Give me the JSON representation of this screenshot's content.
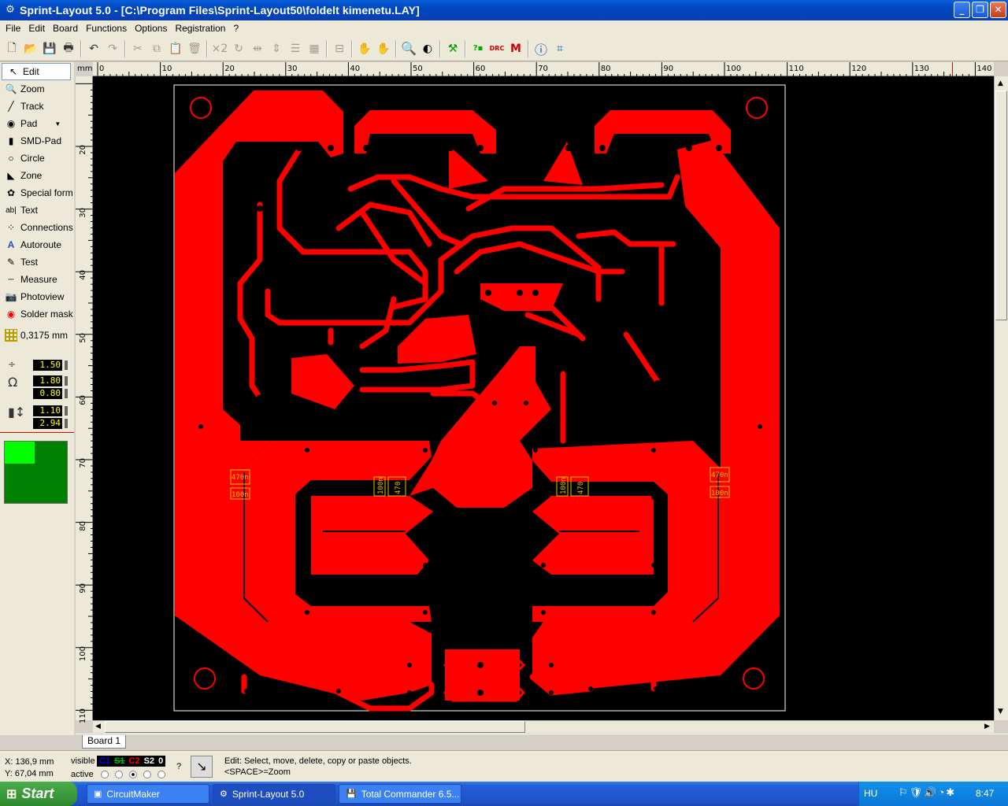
{
  "window": {
    "title": "Sprint-Layout 5.0 - [C:\\Program Files\\Sprint-Layout50\\foldelt kimenetu.LAY]",
    "minimize": "_",
    "maximize": "❐",
    "close": "✕"
  },
  "menu": [
    "File",
    "Edit",
    "Board",
    "Functions",
    "Options",
    "Registration",
    "?"
  ],
  "toolbar": {
    "icons": [
      "new-icon",
      "open-icon",
      "save-icon",
      "print-icon",
      "undo-icon",
      "redo-icon",
      "cut-icon",
      "copy-icon",
      "paste-icon",
      "delete-icon",
      "duplicate-icon",
      "rotate-icon",
      "mirror-h-icon",
      "mirror-v-icon",
      "align-icon",
      "group-icon",
      "ungroup-icon",
      "hide-icon",
      "lock-icon",
      "unlock-icon",
      "zoom-icon",
      "transparency-icon",
      "components-icon",
      "drc-icon",
      "drc-check-icon",
      "macro-icon",
      "info-icon",
      "crop-icon"
    ],
    "x2_label": "×2"
  },
  "tools": [
    {
      "label": "Edit",
      "icon": "pointer-icon"
    },
    {
      "label": "Zoom",
      "icon": "zoom-icon"
    },
    {
      "label": "Track",
      "icon": "track-icon"
    },
    {
      "label": "Pad",
      "icon": "pad-icon"
    },
    {
      "label": "SMD-Pad",
      "icon": "smd-pad-icon"
    },
    {
      "label": "Circle",
      "icon": "circle-icon"
    },
    {
      "label": "Zone",
      "icon": "zone-icon"
    },
    {
      "label": "Special form",
      "icon": "special-form-icon"
    },
    {
      "label": "Text",
      "icon": "text-icon"
    },
    {
      "label": "Connections",
      "icon": "connections-icon"
    },
    {
      "label": "Autoroute",
      "icon": "autoroute-icon"
    },
    {
      "label": "Test",
      "icon": "test-icon"
    },
    {
      "label": "Measure",
      "icon": "measure-icon"
    },
    {
      "label": "Photoview",
      "icon": "photoview-icon"
    },
    {
      "label": "Solder mask",
      "icon": "solder-mask-icon"
    }
  ],
  "grid": "0,3175 mm",
  "values": {
    "track_width": "1.50",
    "pad_outer": "1.80",
    "pad_inner": "0.80",
    "smd_w": "1.10",
    "smd_h": "2.94"
  },
  "ruler": {
    "unit": "mm",
    "top": [
      "0",
      "10",
      "20",
      "30",
      "40",
      "50",
      "60",
      "70",
      "80",
      "90",
      "100",
      "110",
      "120",
      "130",
      "140"
    ],
    "left": [
      "20",
      "30",
      "40",
      "50",
      "60",
      "70",
      "80",
      "90",
      "100",
      "110"
    ]
  },
  "silk_labels": [
    "470n",
    "100n",
    "100n",
    "470",
    "100n",
    "470",
    "470n",
    "100n"
  ],
  "tab": "Board 1",
  "status": {
    "x": "X:  136,9 mm",
    "y": "Y:  67,04 mm",
    "visible_label": "visible",
    "active_label": "active",
    "layers": [
      "C1",
      "S1",
      "C2",
      "S2",
      "0"
    ],
    "layer_colors": [
      "#0000ff",
      "#00c000",
      "#ff0000",
      "#ffffff",
      "#ffffff"
    ],
    "question": "?",
    "hint1": "Edit: Select, move, delete, copy or paste objects.",
    "hint2": "<SPACE>=Zoom"
  },
  "taskbar": {
    "start": "Start",
    "tasks": [
      "CircuitMaker",
      "Sprint-Layout 5.0",
      "Total Commander 6.5..."
    ],
    "lang": "HU",
    "clock": "8:47"
  }
}
